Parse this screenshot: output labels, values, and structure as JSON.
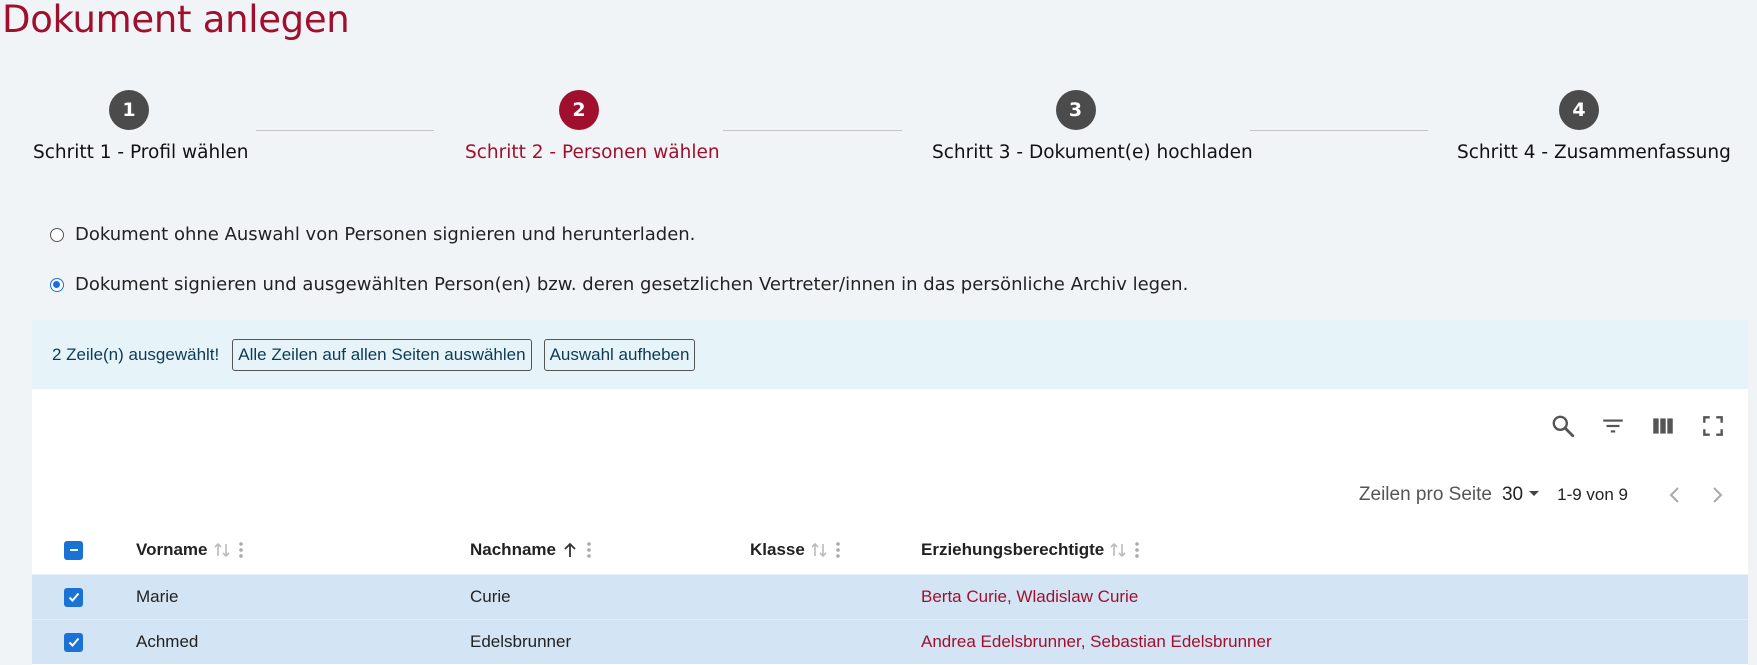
{
  "page": {
    "title": "Dokument anlegen"
  },
  "stepper": {
    "steps": [
      {
        "number": "1",
        "label": "Schritt 1 - Profil wählen",
        "active": false
      },
      {
        "number": "2",
        "label": "Schritt 2 - Personen wählen",
        "active": true
      },
      {
        "number": "3",
        "label": "Schritt 3 - Dokument(e) hochladen",
        "active": false
      },
      {
        "number": "4",
        "label": "Schritt 4 - Zusammenfassung",
        "active": false
      }
    ]
  },
  "options": {
    "option1": {
      "label": "Dokument ohne Auswahl von Personen signieren und herunterladen.",
      "checked": false
    },
    "option2": {
      "label": "Dokument signieren und ausgewählten Person(en) bzw. deren gesetzlichen Vertreter/innen in das persönliche Archiv legen.",
      "checked": true
    }
  },
  "selection_banner": {
    "count_text": "2 Zeile(n) ausgewählt!",
    "select_all_label": "Alle Zeilen auf allen Seiten auswählen",
    "clear_label": "Auswahl aufheben"
  },
  "toolbar": {
    "icons": [
      "search-icon",
      "filter-icon",
      "columns-icon",
      "fullscreen-icon"
    ]
  },
  "pagination": {
    "rows_per_page_label": "Zeilen pro Seite",
    "rows_per_page_value": "30",
    "range": "1-9 von 9"
  },
  "table": {
    "columns": {
      "vorname": "Vorname",
      "nachname": "Nachname",
      "klasse": "Klasse",
      "erziehungsberechtigte": "Erziehungsberechtigte"
    },
    "sorted_column": "Nachname",
    "rows": [
      {
        "vorname": "Marie",
        "nachname": "Curie",
        "klasse": "",
        "erziehungsberechtigte": "Berta Curie, Wladislaw Curie",
        "selected": true
      },
      {
        "vorname": "Achmed",
        "nachname": "Edelsbrunner",
        "klasse": "",
        "erziehungsberechtigte": "Andrea Edelsbrunner, Sebastian Edelsbrunner",
        "selected": true
      }
    ]
  },
  "colors": {
    "accent": "#a0102e",
    "primary": "#1a73d4",
    "banner_bg": "#e6f4fa",
    "selected_row_bg": "#d3e5f5"
  }
}
